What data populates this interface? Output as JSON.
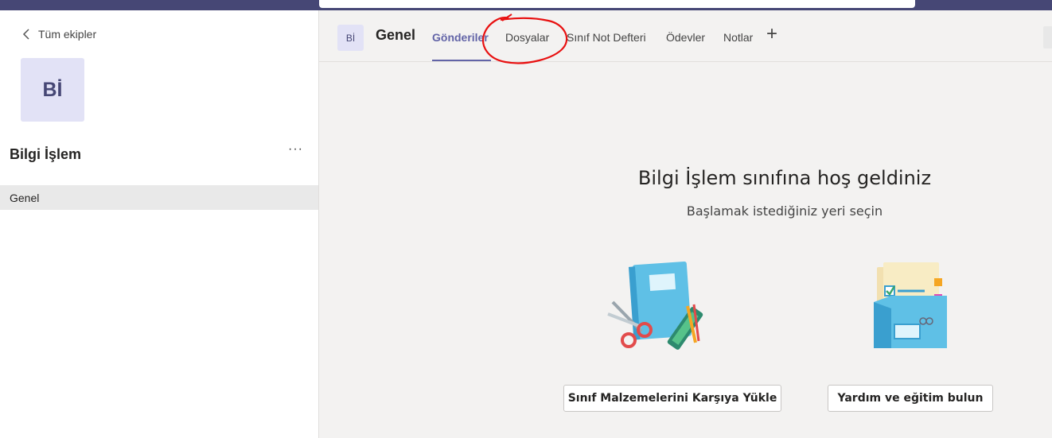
{
  "sidebar": {
    "back_label": "Tüm ekipler",
    "team_initials": "Bİ",
    "team_name": "Bilgi İşlem",
    "more_label": "···",
    "channels": [
      {
        "label": "Genel"
      }
    ]
  },
  "header": {
    "initials": "Bİ",
    "channel_title": "Genel",
    "tabs": [
      {
        "label": "Gönderiler",
        "active": true
      },
      {
        "label": "Dosyalar"
      },
      {
        "label": "Sınıf Not Defteri"
      },
      {
        "label": "Ödevler"
      },
      {
        "label": "Notlar"
      }
    ],
    "add_tab_label": "+"
  },
  "welcome": {
    "title": "Bilgi İşlem sınıfına hoş geldiniz",
    "subtitle": "Başlamak istediğiniz yeri seçin",
    "upload_button": "Sınıf Malzemelerini Karşıya Yükle",
    "help_button": "Yardım ve eğitim bulun"
  },
  "icons": [
    "chevron-left-icon",
    "more-options-icon",
    "add-tab-icon",
    "notebook-scissors-illustration",
    "folder-checklist-illustration"
  ],
  "colors": {
    "accent": "#6264a7",
    "topbar": "#464775",
    "annotation": "#e81010"
  }
}
